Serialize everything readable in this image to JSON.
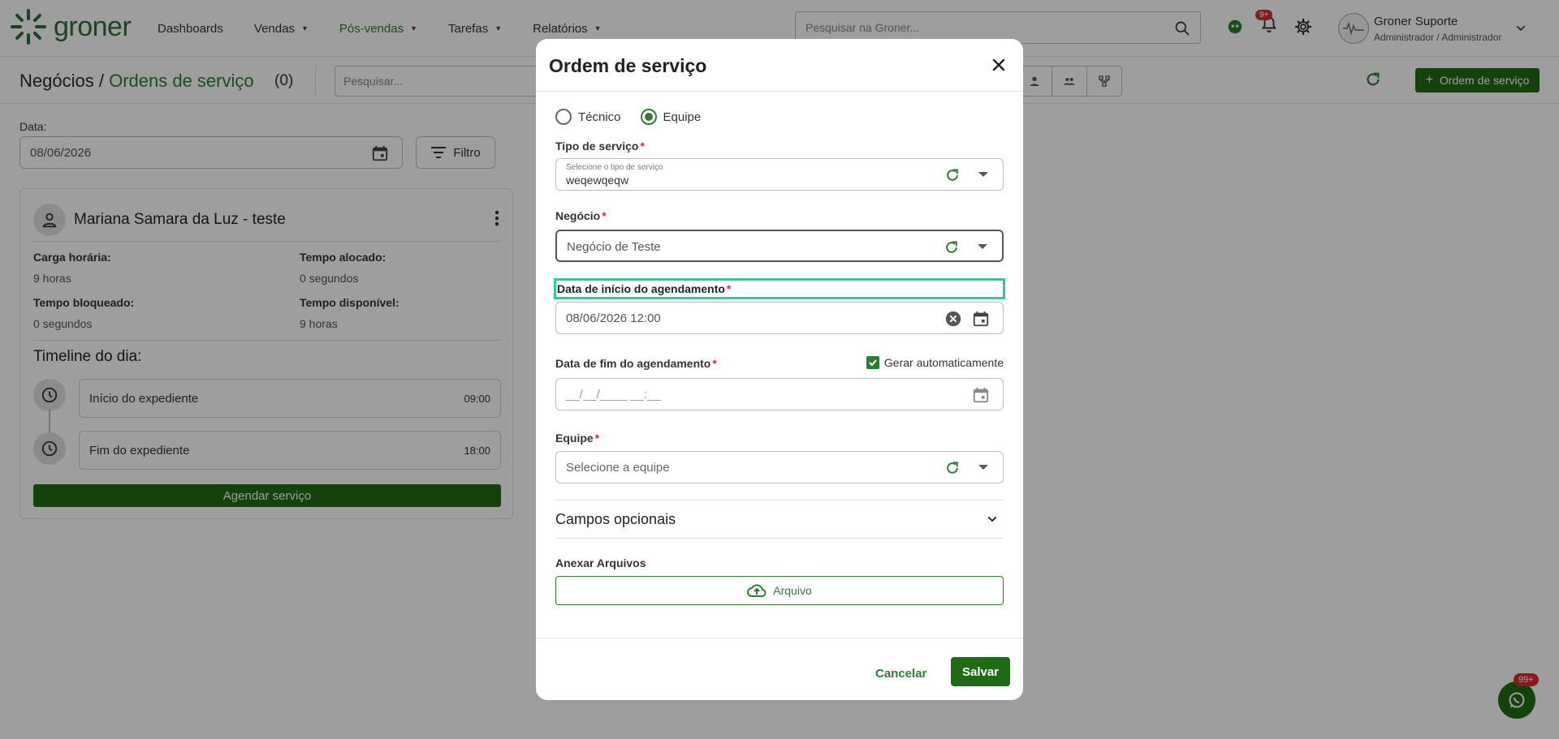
{
  "colors": {
    "brand_green": "#1f6b12",
    "accent_green": "#2e7d32",
    "required_red": "#d32f2f",
    "highlight_teal": "#36c98f"
  },
  "app": {
    "logo_text": "groner"
  },
  "nav": {
    "items": [
      {
        "label": "Dashboards",
        "has_caret": false
      },
      {
        "label": "Vendas",
        "has_caret": true
      },
      {
        "label": "Pós-vendas",
        "has_caret": true
      },
      {
        "label": "Tarefas",
        "has_caret": true
      },
      {
        "label": "Relatórios",
        "has_caret": true
      }
    ],
    "search_placeholder": "Pesquisar na Groner...",
    "notifications_badge": "9+",
    "user_name": "Groner Suporte",
    "user_role": "Administrador / Administrador"
  },
  "subheader": {
    "title_prefix": "Negócios /",
    "title_main": "Ordens de serviço",
    "count": "(0)",
    "search_placeholder": "Pesquisar...",
    "new_button": "Ordem de serviço"
  },
  "filters": {
    "date_label": "Data:",
    "date_value": "08/06/2026",
    "filter_button": "Filtro"
  },
  "tech_card": {
    "name": "Mariana Samara da Luz - teste",
    "stats": {
      "workload_label": "Carga horária:",
      "workload_value": "9 horas",
      "allocated_label": "Tempo alocado:",
      "allocated_value": "0 segundos",
      "blocked_label": "Tempo bloqueado:",
      "blocked_value": "0 segundos",
      "available_label": "Tempo disponível:",
      "available_value": "9 horas"
    },
    "timeline_title": "Timeline do dia:",
    "timeline": [
      {
        "label": "Início do expediente",
        "time": "09:00"
      },
      {
        "label": "Fim do expediente",
        "time": "18:00"
      }
    ],
    "schedule_button": "Agendar serviço"
  },
  "whatsapp": {
    "badge": "99+"
  },
  "modal": {
    "title": "Ordem de serviço",
    "radio_options": [
      {
        "label": "Técnico",
        "selected": false
      },
      {
        "label": "Equipe",
        "selected": true
      }
    ],
    "service_type": {
      "label": "Tipo de serviço",
      "sublabel": "Selecione o tipo de serviço",
      "value": "weqewqeqw"
    },
    "deal": {
      "label": "Negócio",
      "value": "Negócio de Teste"
    },
    "start_date": {
      "label": "Data de início do agendamento",
      "value": "08/06/2026 12:00"
    },
    "end_date": {
      "label": "Data de fim do agendamento",
      "placeholder": "__/__/____ __:__",
      "auto_label": "Gerar automaticamente",
      "auto_checked": true
    },
    "team": {
      "label": "Equipe",
      "placeholder": "Selecione a equipe"
    },
    "optional_fields": "Campos opcionais",
    "attach_label": "Anexar Arquivos",
    "attach_button": "Arquivo",
    "cancel_button": "Cancelar",
    "save_button": "Salvar"
  }
}
